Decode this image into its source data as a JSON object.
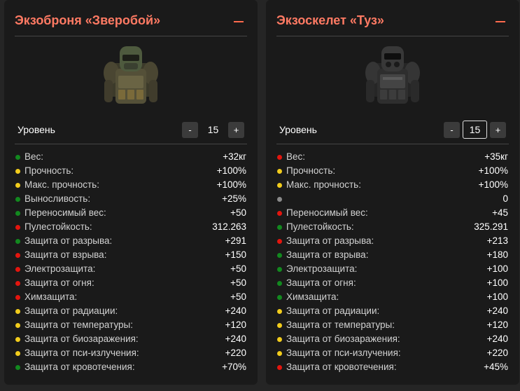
{
  "cards": [
    {
      "title": "Экзоброня «Зверобой»",
      "level_label": "Уровень",
      "level_value": "15",
      "minus_label": "-",
      "plus_label": "+",
      "stats": [
        {
          "label": "Вес:",
          "value": "+32кг",
          "status": "green"
        },
        {
          "label": "Прочность:",
          "value": "+100%",
          "status": "yellow"
        },
        {
          "label": "Макс. прочность:",
          "value": "+100%",
          "status": "yellow"
        },
        {
          "label": "Выносливость:",
          "value": "+25%",
          "status": "green"
        },
        {
          "label": "Переносимый вес:",
          "value": "+50",
          "status": "green"
        },
        {
          "label": "Пулестойкость:",
          "value": "312.263",
          "status": "red"
        },
        {
          "label": "Защита от разрыва:",
          "value": "+291",
          "status": "green"
        },
        {
          "label": "Защита от взрыва:",
          "value": "+150",
          "status": "red"
        },
        {
          "label": "Электрозащита:",
          "value": "+50",
          "status": "red"
        },
        {
          "label": "Защита от огня:",
          "value": "+50",
          "status": "red"
        },
        {
          "label": "Химзащита:",
          "value": "+50",
          "status": "red"
        },
        {
          "label": "Защита от радиации:",
          "value": "+240",
          "status": "yellow"
        },
        {
          "label": "Защита от температуры:",
          "value": "+120",
          "status": "yellow"
        },
        {
          "label": "Защита от биозаражения:",
          "value": "+240",
          "status": "yellow"
        },
        {
          "label": "Защита от пси-излучения:",
          "value": "+220",
          "status": "yellow"
        },
        {
          "label": "Защита от кровотечения:",
          "value": "+70%",
          "status": "green"
        }
      ]
    },
    {
      "title": "Экзоскелет «Туз»",
      "level_label": "Уровень",
      "level_value": "15",
      "minus_label": "-",
      "plus_label": "+",
      "stats": [
        {
          "label": "Вес:",
          "value": "+35кг",
          "status": "red"
        },
        {
          "label": "Прочность:",
          "value": "+100%",
          "status": "yellow"
        },
        {
          "label": "Макс. прочность:",
          "value": "+100%",
          "status": "yellow"
        },
        {
          "label": "",
          "value": "0",
          "status": "gray"
        },
        {
          "label": "Переносимый вес:",
          "value": "+45",
          "status": "red"
        },
        {
          "label": "Пулестойкость:",
          "value": "325.291",
          "status": "green"
        },
        {
          "label": "Защита от разрыва:",
          "value": "+213",
          "status": "red"
        },
        {
          "label": "Защита от взрыва:",
          "value": "+180",
          "status": "green"
        },
        {
          "label": "Электрозащита:",
          "value": "+100",
          "status": "green"
        },
        {
          "label": "Защита от огня:",
          "value": "+100",
          "status": "green"
        },
        {
          "label": "Химзащита:",
          "value": "+100",
          "status": "green"
        },
        {
          "label": "Защита от радиации:",
          "value": "+240",
          "status": "yellow"
        },
        {
          "label": "Защита от температуры:",
          "value": "+120",
          "status": "yellow"
        },
        {
          "label": "Защита от биозаражения:",
          "value": "+240",
          "status": "yellow"
        },
        {
          "label": "Защита от пси-излучения:",
          "value": "+220",
          "status": "yellow"
        },
        {
          "label": "Защита от кровотечения:",
          "value": "+45%",
          "status": "red"
        }
      ]
    }
  ],
  "colors": {
    "accent": "#ff7a63",
    "green": "#12891f",
    "red": "#e3150e",
    "yellow": "#f2cc1c",
    "gray": "#8a8a8a",
    "card_bg": "#1a1a1a",
    "page_bg": "#252525"
  }
}
